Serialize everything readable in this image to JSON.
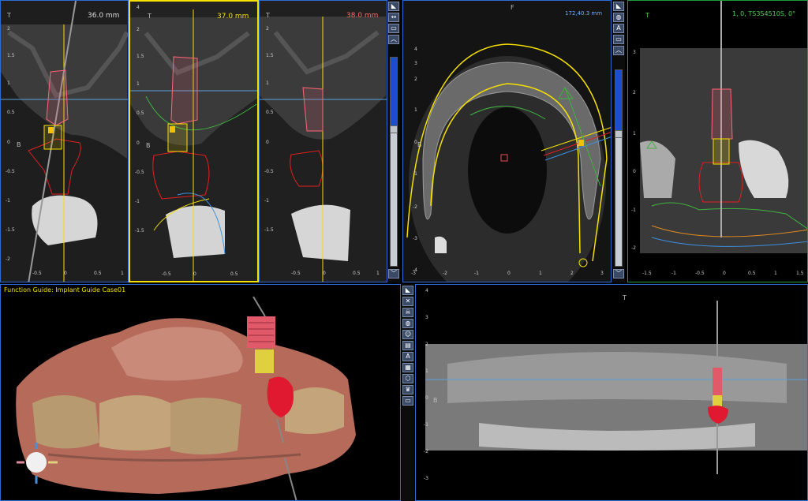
{
  "colors": {
    "ct": "#2c2c2c",
    "implant": "#ff6677",
    "yellow": "#f5e000",
    "cyan": "#3b8fe0",
    "green": "#3fb23f",
    "red": "#e02020",
    "border_yellow": "#f5e000",
    "border_blue": "#2f6bd6",
    "border_green": "#1f9a3a",
    "scroll_fill": "#1c4fd0"
  },
  "slice1": {
    "tag": "T",
    "mm": "36.0 mm",
    "side": "B",
    "yticks": [
      "2",
      "1.5",
      "1",
      "0.5",
      "0",
      "-0.5",
      "-1",
      "-1.5",
      "-2"
    ],
    "xticks": [
      "-0.5",
      "0",
      "0.5",
      "1"
    ]
  },
  "slice2": {
    "tag": "T",
    "mm": "37.0 mm",
    "side": "B",
    "yticks": [
      "2",
      "1.5",
      "1",
      "0.5",
      "0",
      "-0.5",
      "-1",
      "-1.5"
    ],
    "xticks": [
      "-0.5",
      "0",
      "0.5"
    ],
    "ytop": "4"
  },
  "slice3": {
    "tag": "T",
    "mm": "38.0 mm",
    "yticks": [
      "2",
      "1.5",
      "1",
      "0.5",
      "0",
      "-0.5",
      "-1",
      "-1.5"
    ],
    "xticks": [
      "-0.5",
      "0",
      "0.5",
      "1"
    ]
  },
  "axial": {
    "tag": "F",
    "mm": "172,40.3 mm",
    "side": "B",
    "yticks": [
      "4",
      "3",
      "2",
      "1",
      "0",
      "-1",
      "-2",
      "-3",
      "-4"
    ],
    "xticks": [
      "-3",
      "-2",
      "-1",
      "0",
      "1",
      "2",
      "3"
    ]
  },
  "cross": {
    "tag": "T",
    "info": "1, 0, TS3S4510S, 0°",
    "yticks": [
      "3",
      "2",
      "1",
      "0",
      "-1",
      "-2"
    ],
    "xticks": [
      "-1.5",
      "-1",
      "-0.5",
      "0",
      "0.5",
      "1",
      "1.5"
    ]
  },
  "render3d": {
    "title": "Function Guide: Implant Guide Case01"
  },
  "pano": {
    "tag": "T",
    "side": "B",
    "yticks": [
      "4",
      "3",
      "2",
      "1",
      "0",
      "-1",
      "-2",
      "-3"
    ]
  },
  "toolbar1": {
    "icons": [
      "slice-icon",
      "measure-icon",
      "implant-icon",
      "up-arrow-icon"
    ]
  },
  "toolbar2": {
    "icons": [
      "slice-icon",
      "nerve-icon",
      "text-icon",
      "implant-icon",
      "up-arrow-icon"
    ]
  },
  "toolbar3": {
    "icons": [
      "slice-icon",
      "cut-icon",
      "skull-icon",
      "nerve-icon",
      "face-icon",
      "teeth-icon",
      "text-icon",
      "grid-icon",
      "mesh-icon",
      "crown-icon",
      "implant-icon"
    ]
  },
  "glyphs": {
    "slice": "◣",
    "measure": "↔",
    "implant": "▭",
    "up": "︿",
    "down": "﹀",
    "nerve": "◍",
    "text": "A",
    "cut": "✕",
    "skull": "☠",
    "face": "☺",
    "teeth": "▤",
    "grid": "▦",
    "mesh": "⬡",
    "crown": "♛"
  }
}
